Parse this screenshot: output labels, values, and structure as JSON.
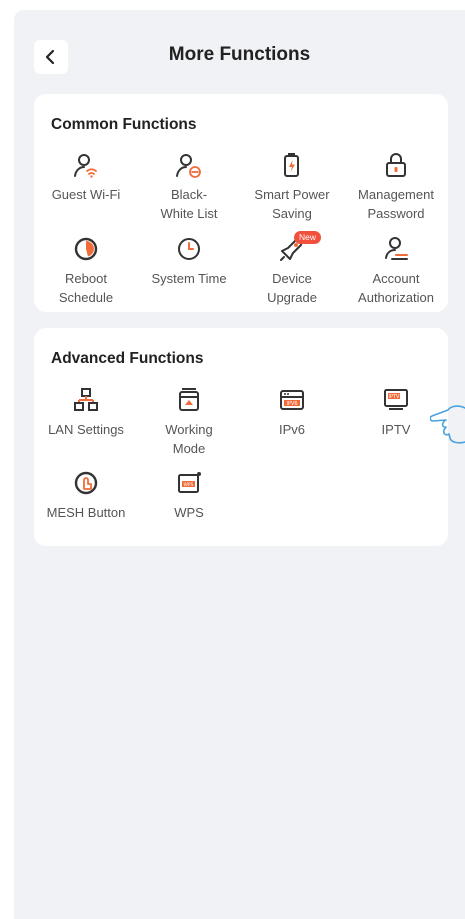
{
  "header": {
    "title": "More Functions"
  },
  "common": {
    "title": "Common Functions",
    "items": [
      {
        "label": "Guest Wi-Fi",
        "icon": "guest-wifi-icon"
      },
      {
        "label": "Black-\nWhite List",
        "icon": "black-white-list-icon"
      },
      {
        "label": "Smart Power\nSaving",
        "icon": "smart-power-saving-icon"
      },
      {
        "label": "Management\nPassword",
        "icon": "lock-icon"
      },
      {
        "label": "Reboot\nSchedule",
        "icon": "reboot-schedule-icon"
      },
      {
        "label": "System Time",
        "icon": "clock-icon"
      },
      {
        "label": "Device\nUpgrade",
        "icon": "rocket-icon",
        "badge": "New"
      },
      {
        "label": "Account\nAuthorization",
        "icon": "account-authorization-icon"
      }
    ]
  },
  "advanced": {
    "title": "Advanced Functions",
    "items": [
      {
        "label": "LAN Settings",
        "icon": "lan-icon"
      },
      {
        "label": "Working\nMode",
        "icon": "working-mode-icon"
      },
      {
        "label": "IPv6",
        "icon": "ipv6-icon",
        "icon_text": "IPV6"
      },
      {
        "label": "IPTV",
        "icon": "iptv-icon",
        "icon_text": "IPTV"
      },
      {
        "label": "MESH Button",
        "icon": "mesh-button-icon"
      },
      {
        "label": "WPS",
        "icon": "wps-icon",
        "icon_text": "WPS"
      }
    ]
  },
  "colors": {
    "accent": "#f26b3a",
    "icon": "#333333",
    "background": "#f1f2f6"
  }
}
